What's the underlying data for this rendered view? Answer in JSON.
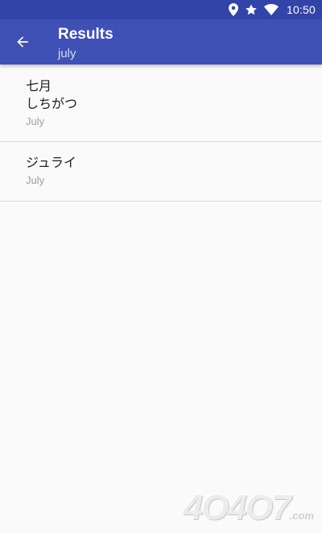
{
  "status_bar": {
    "icons": [
      "location-icon",
      "star-icon",
      "wifi-icon"
    ],
    "time": "10:50"
  },
  "app_bar": {
    "title": "Results",
    "subtitle": "july",
    "back_icon": "arrow-back-icon"
  },
  "results": [
    {
      "lines": [
        "七月",
        "しちがつ"
      ],
      "meaning": "July"
    },
    {
      "lines": [
        "ジュライ"
      ],
      "meaning": "July"
    }
  ],
  "watermark": {
    "text": "4O4O7",
    "suffix": ".com"
  },
  "colors": {
    "status_bar": "#3244a8",
    "app_bar": "#3f51b5",
    "background": "#fafafa",
    "primary_text": "#212121",
    "secondary_text": "#9e9e9e",
    "divider": "#dcdcdc"
  }
}
